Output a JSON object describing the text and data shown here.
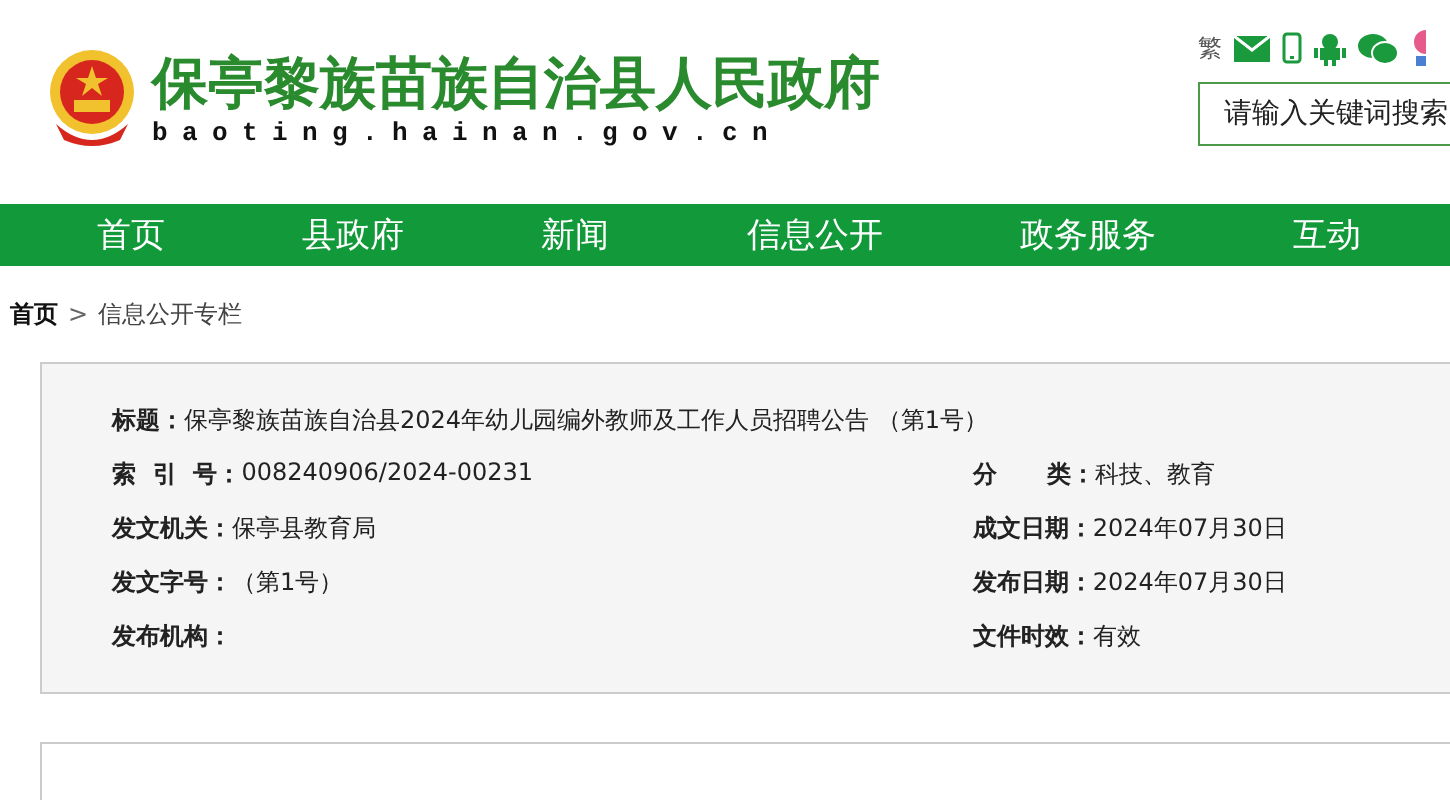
{
  "header": {
    "site_name": "保亭黎族苗族自治县人民政府",
    "domain": "baoting.hainan.gov.cn",
    "traditional_toggle": "繁",
    "search": {
      "placeholder": "请输入关键词搜索"
    }
  },
  "nav": [
    "首页",
    "县政府",
    "新闻",
    "信息公开",
    "政务服务",
    "互动"
  ],
  "breadcrumb": {
    "home": "首页",
    "separator": ">",
    "current": "信息公开专栏"
  },
  "meta": {
    "title": {
      "label": "标题：",
      "value": "保亭黎族苗族自治县2024年幼儿园编外教师及工作人员招聘公告 （第1号）"
    },
    "rows": [
      {
        "left": {
          "label": "索  引  号：",
          "value": "008240906/2024-00231"
        },
        "right": {
          "label": "分      类：",
          "value": "科技、教育"
        }
      },
      {
        "left": {
          "label": "发文机关：",
          "value": "保亭县教育局"
        },
        "right": {
          "label": "成文日期：",
          "value": "2024年07月30日"
        }
      },
      {
        "left": {
          "label": "发文字号：",
          "value": "（第1号）"
        },
        "right": {
          "label": "发布日期：",
          "value": "2024年07月30日"
        }
      },
      {
        "left": {
          "label": "发布机构："
        },
        "right": {
          "label": "文件时效：",
          "value": "有效"
        }
      }
    ]
  }
}
